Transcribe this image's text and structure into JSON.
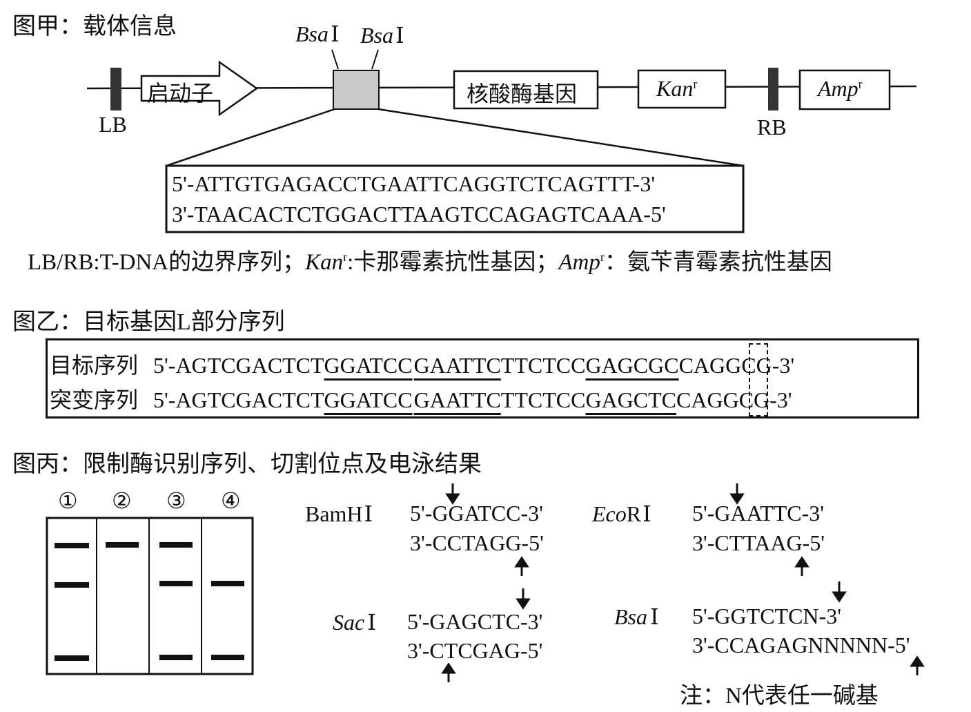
{
  "figA": {
    "title": "图甲：载体信息",
    "bsa_left": "Bsa",
    "bsa_right": "Bsa",
    "bsa_roman": "Ⅰ",
    "promoter": "启动子",
    "nuclease": "核酸酶基因",
    "kan": "Kan",
    "amp": "Amp",
    "sup_r": "r",
    "lb": "LB",
    "rb": "RB",
    "insert_top": "5'-ATTGTGAGACCTGAATTCAGGTCTCAGTTT-3'",
    "insert_bottom": "3'-TAACACTCTGGACTTAAGTCCAGAGTCAAA-5'",
    "legend_a": "LB/RB:T-DNA的边界序列；",
    "legend_kan": "Kan",
    "legend_b": ":卡那霉素抗性基因；",
    "legend_amp": "Amp",
    "legend_c": "：氨苄青霉素抗性基因"
  },
  "figB": {
    "title": "图乙：目标基因L部分序列",
    "rows": [
      {
        "label": "目标序列",
        "s1": "5'-AGTCGACTCT",
        "u1": "GGATCC",
        "u2": "GAATTC",
        "s2": "TTCTCC",
        "u3a": "GAGC",
        "mut": "G",
        "u3b": "C",
        "s3": "CAGGCG-3'"
      },
      {
        "label": "突变序列",
        "s1": "5'-AGTCGACTCT",
        "u1": "GGATCC",
        "u2": "GAATTC",
        "s2": "TTCTCC",
        "u3a": "GAGC",
        "mut": "T",
        "u3b": "C",
        "s3": "CAGGCG-3'"
      }
    ]
  },
  "figC": {
    "title": "图丙：限制酶识别序列、切割位点及电泳结果",
    "lanes": [
      "①",
      "②",
      "③",
      "④"
    ],
    "gel_bands": {
      "lane1": [
        "high",
        "mid",
        "low"
      ],
      "lane2": [
        "high"
      ],
      "lane3": [
        "high",
        "mid",
        "low"
      ],
      "lane4": [
        "mid",
        "low"
      ]
    },
    "enzymes": [
      {
        "name": "BamH",
        "roman": "Ⅰ",
        "top": "5'-GGATCC-3'",
        "bottom": "3'-CCTAGG-5'"
      },
      {
        "name_italic": "Eco",
        "name_rest": "R",
        "roman": "Ⅰ",
        "top": "5'-GAATTC-3'",
        "bottom": "3'-CTTAAG-5'"
      },
      {
        "name_italic": "Sac",
        "roman": "Ⅰ",
        "top": "5'-GAGCTC-3'",
        "bottom": "3'-CTCGAG-5'"
      },
      {
        "name_italic": "Bsa",
        "roman": "Ⅰ",
        "top": "5'-GGTCTCN-3'",
        "bottom": "3'-CCAGAGNNNNN-5'"
      }
    ],
    "note": "注：N代表任一碱基"
  }
}
